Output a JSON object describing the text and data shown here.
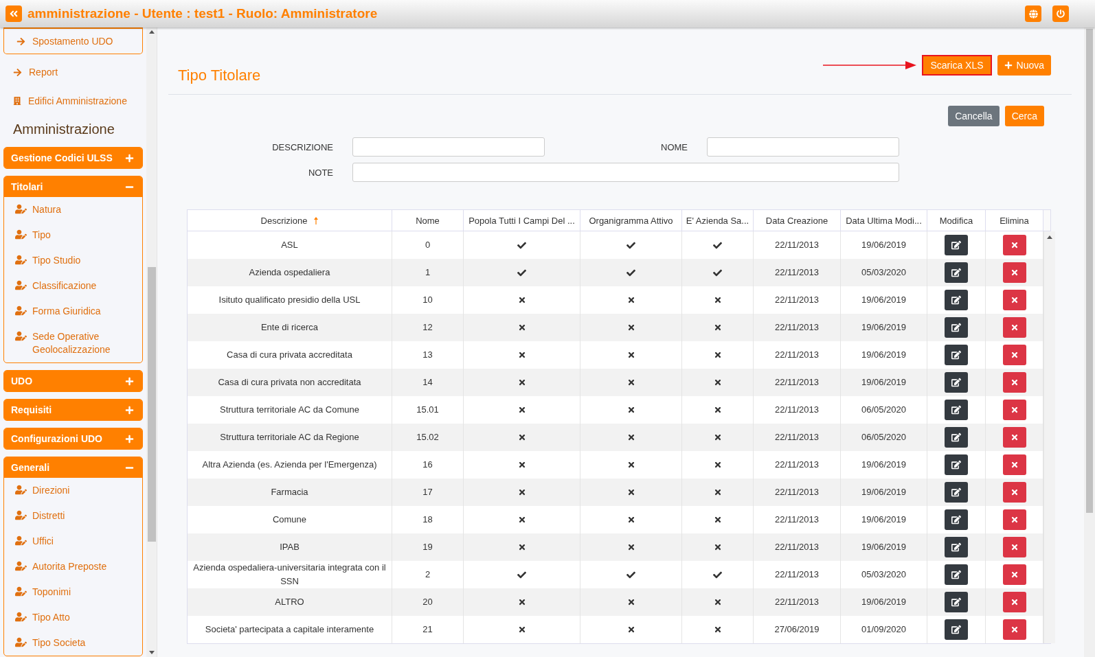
{
  "header": {
    "title": "amministrazione - Utente : test1 - Ruolo: Amministratore"
  },
  "sidebar": {
    "top_link": "Spostamento UDO",
    "links": [
      "Report",
      "Edifici Amministrazione"
    ],
    "section_title": "Amministrazione",
    "groups": [
      {
        "label": "Gestione Codici ULSS",
        "expanded": false
      },
      {
        "label": "Titolari",
        "expanded": true,
        "items": [
          "Natura",
          "Tipo",
          "Tipo Studio",
          "Classificazione",
          "Forma Giuridica",
          "Sede Operative Geolocalizzazione"
        ]
      },
      {
        "label": "UDO",
        "expanded": false
      },
      {
        "label": "Requisiti",
        "expanded": false
      },
      {
        "label": "Configurazioni UDO",
        "expanded": false
      },
      {
        "label": "Generali",
        "expanded": true,
        "items": [
          "Direzioni",
          "Distretti",
          "Uffici",
          "Autorita Preposte",
          "Toponimi",
          "Tipo Atto",
          "Tipo Societa"
        ]
      }
    ]
  },
  "page": {
    "title": "Tipo Titolare",
    "export_button": {
      "label": "Scarica XLS",
      "highlighted": true
    },
    "new_button": "Nuova",
    "clear_button": "Cancella",
    "search_button": "Cerca"
  },
  "filters": [
    {
      "label": "DESCRIZIONE"
    },
    {
      "label": "NOME"
    },
    {
      "label": "NOTE"
    }
  ],
  "table": {
    "columns": [
      "Descrizione",
      "Nome",
      "Popola Tutti I Campi Del ...",
      "Organigramma Attivo",
      "E' Azienda Sa...",
      "Data Creazione",
      "Data Ultima Modi...",
      "Modifica",
      "Elimina"
    ],
    "rows": [
      {
        "descrizione": "ASL",
        "nome": "0",
        "popola": true,
        "organigramma": true,
        "azienda": true,
        "creazione": "22/11/2013",
        "modifica": "19/06/2019"
      },
      {
        "descrizione": "Azienda ospedaliera",
        "nome": "1",
        "popola": true,
        "organigramma": true,
        "azienda": true,
        "creazione": "22/11/2013",
        "modifica": "05/03/2020"
      },
      {
        "descrizione": "Isituto qualificato presidio della USL",
        "nome": "10",
        "popola": false,
        "organigramma": false,
        "azienda": false,
        "creazione": "22/11/2013",
        "modifica": "19/06/2019"
      },
      {
        "descrizione": "Ente di ricerca",
        "nome": "12",
        "popola": false,
        "organigramma": false,
        "azienda": false,
        "creazione": "22/11/2013",
        "modifica": "19/06/2019"
      },
      {
        "descrizione": "Casa di cura privata accreditata",
        "nome": "13",
        "popola": false,
        "organigramma": false,
        "azienda": false,
        "creazione": "22/11/2013",
        "modifica": "19/06/2019"
      },
      {
        "descrizione": "Casa di cura privata non accreditata",
        "nome": "14",
        "popola": false,
        "organigramma": false,
        "azienda": false,
        "creazione": "22/11/2013",
        "modifica": "19/06/2019"
      },
      {
        "descrizione": "Struttura territoriale AC da Comune",
        "nome": "15.01",
        "popola": false,
        "organigramma": false,
        "azienda": false,
        "creazione": "22/11/2013",
        "modifica": "06/05/2020"
      },
      {
        "descrizione": "Struttura territoriale AC da Regione",
        "nome": "15.02",
        "popola": false,
        "organigramma": false,
        "azienda": false,
        "creazione": "22/11/2013",
        "modifica": "06/05/2020"
      },
      {
        "descrizione": "Altra Azienda (es. Azienda per l'Emergenza)",
        "nome": "16",
        "popola": false,
        "organigramma": false,
        "azienda": false,
        "creazione": "22/11/2013",
        "modifica": "19/06/2019"
      },
      {
        "descrizione": "Farmacia",
        "nome": "17",
        "popola": false,
        "organigramma": false,
        "azienda": false,
        "creazione": "22/11/2013",
        "modifica": "19/06/2019"
      },
      {
        "descrizione": "Comune",
        "nome": "18",
        "popola": false,
        "organigramma": false,
        "azienda": false,
        "creazione": "22/11/2013",
        "modifica": "19/06/2019"
      },
      {
        "descrizione": "IPAB",
        "nome": "19",
        "popola": false,
        "organigramma": false,
        "azienda": false,
        "creazione": "22/11/2013",
        "modifica": "19/06/2019"
      },
      {
        "descrizione": "Azienda ospedaliera-universitaria integrata con il SSN",
        "nome": "2",
        "popola": true,
        "organigramma": true,
        "azienda": true,
        "creazione": "22/11/2013",
        "modifica": "05/03/2020"
      },
      {
        "descrizione": "ALTRO",
        "nome": "20",
        "popola": false,
        "organigramma": false,
        "azienda": false,
        "creazione": "22/11/2013",
        "modifica": "19/06/2019"
      },
      {
        "descrizione": "Societa' partecipata a capitale interamente",
        "nome": "21",
        "popola": false,
        "organigramma": false,
        "azienda": false,
        "creazione": "27/06/2019",
        "modifica": "01/09/2020"
      }
    ]
  }
}
